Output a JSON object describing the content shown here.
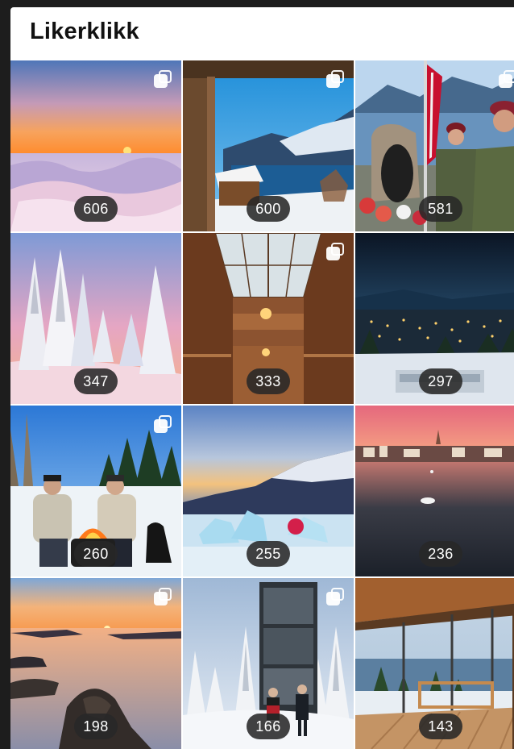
{
  "header": {
    "title": "Likerklikk"
  },
  "grid": {
    "tiles": [
      {
        "likes": "606",
        "multi": true,
        "icon": "multiple-images-icon"
      },
      {
        "likes": "600",
        "multi": true,
        "icon": "multiple-images-icon"
      },
      {
        "likes": "581",
        "multi": true,
        "icon": "multiple-images-icon"
      },
      {
        "likes": "347",
        "multi": false,
        "icon": ""
      },
      {
        "likes": "333",
        "multi": true,
        "icon": "multiple-images-icon"
      },
      {
        "likes": "297",
        "multi": false,
        "icon": ""
      },
      {
        "likes": "260",
        "multi": true,
        "icon": "multiple-images-icon"
      },
      {
        "likes": "255",
        "multi": false,
        "icon": ""
      },
      {
        "likes": "236",
        "multi": false,
        "icon": ""
      },
      {
        "likes": "198",
        "multi": true,
        "icon": "multiple-images-icon"
      },
      {
        "likes": "166",
        "multi": true,
        "icon": "multiple-images-icon"
      },
      {
        "likes": "143",
        "multi": false,
        "icon": ""
      }
    ]
  },
  "colors": {
    "page_background": "#1d1d1d",
    "panel_background": "#ffffff",
    "badge_background": "#282828",
    "badge_text": "#ffffff"
  }
}
